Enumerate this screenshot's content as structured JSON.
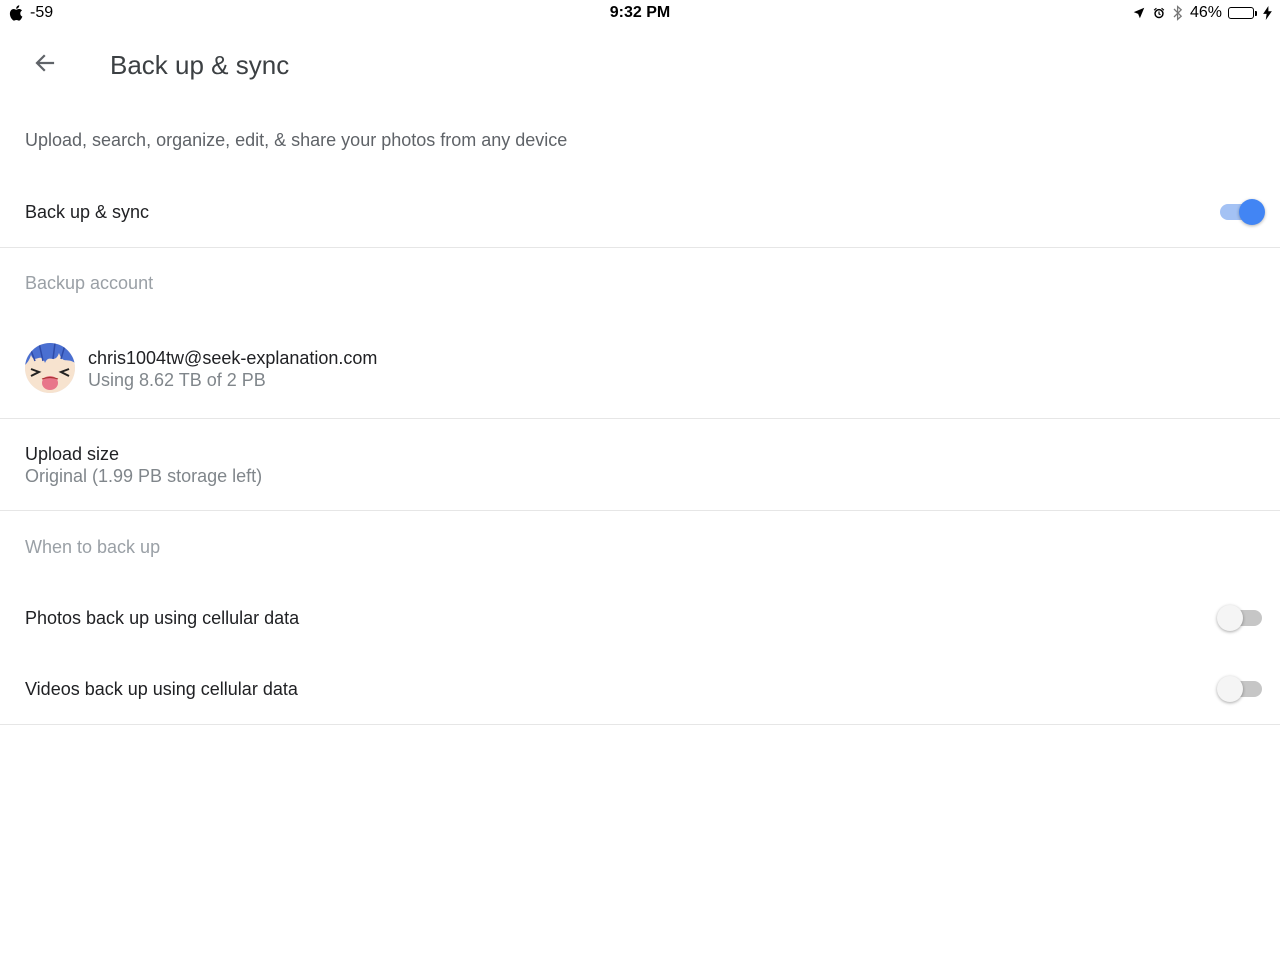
{
  "status_bar": {
    "signal": "-59",
    "time": "9:32 PM",
    "battery": "46%",
    "battery_level": 0.46,
    "icons": [
      "apple-icon",
      "location-arrow-icon",
      "alarm-icon",
      "bluetooth-icon",
      "battery-icon",
      "charging-bolt-icon"
    ]
  },
  "header": {
    "back_icon": "arrow-left-icon",
    "title": "Back up & sync"
  },
  "description": "Upload, search, organize, edit, & share your photos from any device",
  "backup_sync": {
    "label": "Back up & sync",
    "enabled": true
  },
  "backup_account": {
    "heading": "Backup account",
    "email": "chris1004tw@seek-explanation.com",
    "usage": "Using 8.62 TB of 2 PB"
  },
  "upload_size": {
    "title": "Upload size",
    "value": "Original (1.99 PB storage left)"
  },
  "when_to_back_up": {
    "heading": "When to back up",
    "photos": {
      "label": "Photos back up using cellular data",
      "enabled": false
    },
    "videos": {
      "label": "Videos back up using cellular data",
      "enabled": false
    }
  },
  "colors": {
    "accent": "#4285f4",
    "accent_track": "#a4c2f4",
    "secondary_text": "#80868b",
    "divider": "#e6e6e6"
  }
}
